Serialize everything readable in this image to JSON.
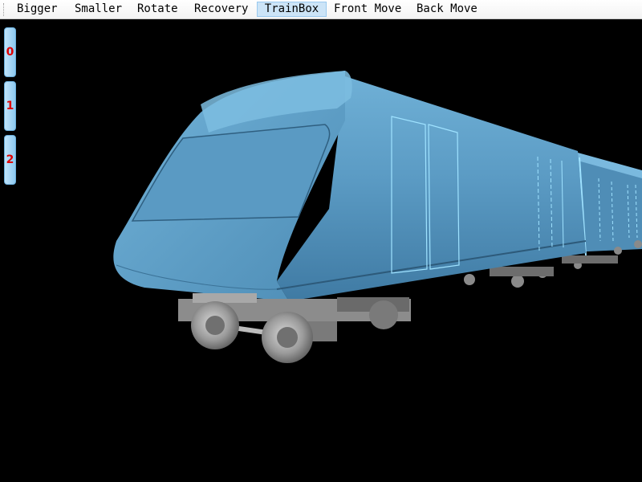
{
  "menu": {
    "items": [
      {
        "label": "Bigger"
      },
      {
        "label": "Smaller"
      },
      {
        "label": "Rotate"
      },
      {
        "label": "Recovery"
      },
      {
        "label": "TrainBox",
        "active": true
      },
      {
        "label": "Front Move"
      },
      {
        "label": "Back Move"
      }
    ]
  },
  "side_buttons": [
    {
      "label": "0"
    },
    {
      "label": "1"
    },
    {
      "label": "2"
    }
  ],
  "scene": {
    "subject": "train-3d-model",
    "body_color": "#5e9ec6",
    "background": "#000000"
  }
}
